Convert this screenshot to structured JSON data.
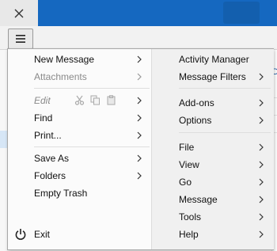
{
  "menu": {
    "left": [
      {
        "id": "new-message",
        "label": "New Message",
        "submenu": true,
        "disabled": false
      },
      {
        "id": "attachments",
        "label": "Attachments",
        "submenu": true,
        "disabled": true
      },
      {
        "id": "edit",
        "label": "Edit",
        "submenu": true,
        "disabled": true
      },
      {
        "id": "find",
        "label": "Find",
        "submenu": true,
        "disabled": false
      },
      {
        "id": "print",
        "label": "Print...",
        "submenu": true,
        "disabled": false
      },
      {
        "id": "save-as",
        "label": "Save As",
        "submenu": true,
        "disabled": false
      },
      {
        "id": "folders",
        "label": "Folders",
        "submenu": true,
        "disabled": false
      },
      {
        "id": "empty-trash",
        "label": "Empty Trash",
        "submenu": false,
        "disabled": false
      },
      {
        "id": "exit",
        "label": "Exit",
        "submenu": false,
        "disabled": false
      }
    ],
    "right": [
      {
        "id": "activity-manager",
        "label": "Activity Manager",
        "submenu": false
      },
      {
        "id": "message-filters",
        "label": "Message Filters",
        "submenu": true
      },
      {
        "id": "add-ons",
        "label": "Add-ons",
        "submenu": true
      },
      {
        "id": "options",
        "label": "Options",
        "submenu": true
      },
      {
        "id": "file",
        "label": "File",
        "submenu": true
      },
      {
        "id": "view",
        "label": "View",
        "submenu": true
      },
      {
        "id": "go",
        "label": "Go",
        "submenu": true
      },
      {
        "id": "message",
        "label": "Message",
        "submenu": true
      },
      {
        "id": "tools",
        "label": "Tools",
        "submenu": true
      },
      {
        "id": "help",
        "label": "Help",
        "submenu": true
      }
    ],
    "edit_icons": [
      "cut-icon",
      "copy-icon",
      "paste-icon"
    ]
  },
  "colors": {
    "titlebar": "#1568c0",
    "accent": "#1f5fa8",
    "disabled_text": "#8a8a8a"
  }
}
